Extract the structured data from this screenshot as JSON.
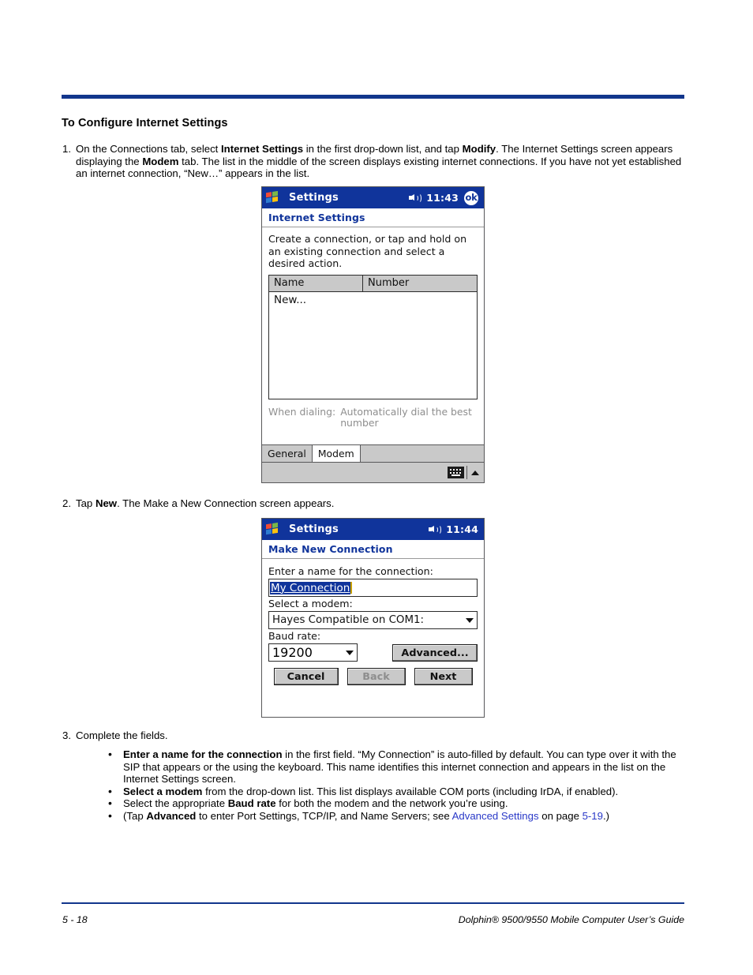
{
  "section": {
    "title": "To Configure Internet Settings"
  },
  "steps": [
    {
      "number": "1.",
      "html": "On the Connections tab, select <b>Internet Settings</b> in the first drop-down list, and tap <b>Modify</b>. The Internet Settings screen appears displaying the <b>Modem</b> tab. The list in the middle of the screen displays existing internet connections. If you have not yet established an internet connection, “New…” appears in the list."
    },
    {
      "number": "2.",
      "html": "Tap <b>New</b>. The Make a New Connection screen appears."
    },
    {
      "number": "3.",
      "html": "Complete the fields."
    }
  ],
  "bullets": [
    {
      "dot": "•",
      "html": "<b>Enter a name for the connection</b> in the first field. “My Connection” is auto-filled by default. You can type over it with the SIP that appears or the using the keyboard. This name identifies this internet connection and  appears in the list on the Internet Settings screen."
    },
    {
      "dot": "•",
      "html": "<b>Select a modem</b> from the drop-down list. This list displays available COM ports (including IrDA, if enabled)."
    },
    {
      "dot": "•",
      "html": "Select the appropriate <b>Baud rate</b> for both the modem and the network you’re using."
    },
    {
      "dot": "•",
      "html": "(Tap <b>Advanced</b> to enter Port Settings, TCP/IP, and Name Servers; see <span class=\"lnk\">Advanced Settings</span> on page <span class=\"lnk\">5-19</span>.)"
    }
  ],
  "footer": {
    "page": "5 - 18",
    "title": "Dolphin® 9500/9550 Mobile Computer User’s Guide"
  },
  "colors": {
    "rule_blue": "#12368c",
    "titlebar_blue": "#10349b",
    "link_blue": "#2a39c8",
    "chrome_gray": "#c9c9c9",
    "disabled_gray": "#8e8e8e"
  },
  "screen1": {
    "titlebar": {
      "app": "Settings",
      "clock": "11:43",
      "ok_label": "ok",
      "speaker_icon": "speaker-icon",
      "start_icon": "windows-start-icon"
    },
    "caption": "Internet Settings",
    "instructions": "Create a connection, or tap and hold on an existing connection and select a desired action.",
    "table": {
      "headers": [
        "Name",
        "Number"
      ],
      "rows": [
        [
          "New...",
          ""
        ]
      ]
    },
    "when_dialing": {
      "label": "When dialing:",
      "value": "Automatically dial the best number"
    },
    "tabs": [
      {
        "label": "General",
        "active": false
      },
      {
        "label": "Modem",
        "active": true
      }
    ],
    "sip": {
      "keyboard_icon": "keyboard-icon",
      "caret_icon": "caret-up-icon"
    }
  },
  "screen2": {
    "titlebar": {
      "app": "Settings",
      "clock": "11:44",
      "speaker_icon": "speaker-icon",
      "start_icon": "windows-start-icon"
    },
    "caption": "Make New Connection",
    "name_label": "Enter a name for the connection:",
    "name_value": "My Connection",
    "modem_label": "Select a modem:",
    "modem_value": "Hayes Compatible on COM1:",
    "baud_label": "Baud rate:",
    "baud_value": "19200",
    "advanced_label": "Advanced...",
    "buttons": [
      {
        "label": "Cancel",
        "disabled": false
      },
      {
        "label": "Back",
        "disabled": true
      },
      {
        "label": "Next",
        "disabled": false
      }
    ]
  }
}
